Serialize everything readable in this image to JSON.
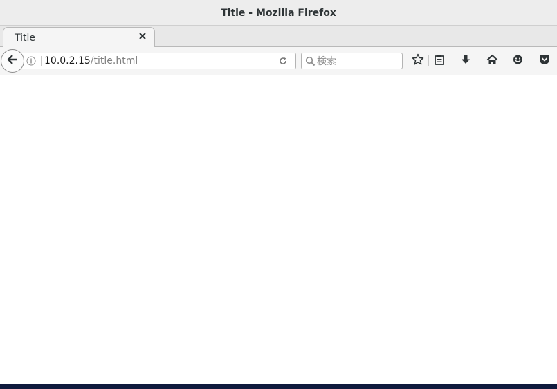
{
  "window": {
    "title": "Title - Mozilla Firefox"
  },
  "tabs": [
    {
      "label": "Title",
      "active": true
    }
  ],
  "navbar": {
    "url_host": "10.0.2.15",
    "url_path": "/title.html",
    "search_placeholder": "検索"
  },
  "icons": {
    "back": "back-arrow-icon",
    "info": "info-icon",
    "reload": "reload-icon",
    "search": "search-icon",
    "bookmark": "star-icon",
    "library": "clipboard-icon",
    "downloads": "download-arrow-icon",
    "home": "home-icon",
    "hello": "smiley-icon",
    "pocket": "pocket-icon",
    "new_tab": "plus-icon",
    "close_tab": "close-icon"
  },
  "colors": {
    "new_tab_plus": "#3d7cd4",
    "desktop_strip": "#0f1a3d"
  }
}
